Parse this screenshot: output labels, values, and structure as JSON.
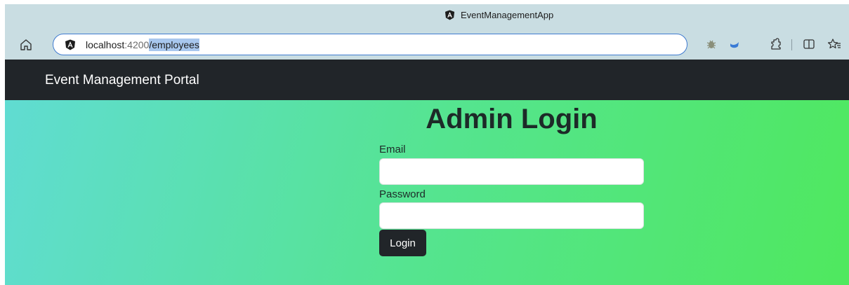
{
  "browser": {
    "window_title": "EventManagementApp",
    "address": {
      "host": "localhost",
      "port": ":4200",
      "path": "/employees"
    },
    "icons": {
      "home": "home-icon",
      "site": "angular-icon",
      "extension_bug": "bug-extension-icon",
      "extension_blue": "blue-extension-icon",
      "extensions": "extensions-icon",
      "split_screen": "split-screen-icon",
      "favorites": "favorites-icon"
    }
  },
  "navbar": {
    "brand": "Event Management Portal",
    "background": "#212529"
  },
  "login": {
    "title": "Admin Login",
    "email_label": "Email",
    "email_value": "",
    "password_label": "Password",
    "password_value": "",
    "button_label": "Login"
  },
  "colors": {
    "gradient_start": "#60dcd2",
    "gradient_end": "#4fe85e",
    "browser_chrome": "#c9dde2",
    "address_border": "#3f7bd0"
  }
}
